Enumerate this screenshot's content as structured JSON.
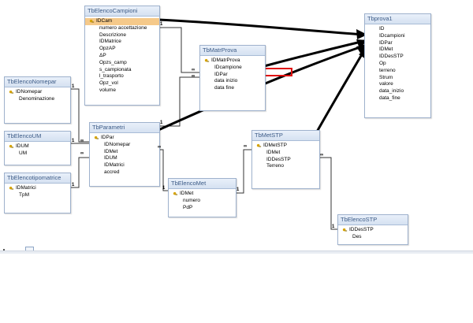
{
  "tables": {
    "elenco_campioni": {
      "title": "TbElencoCampioni",
      "fields": [
        "IDCam",
        "numero accettazione",
        "Descrizione",
        "IDMatrice",
        "OpzAP",
        "ΔP",
        "Opzs_camp",
        "s_campionata",
        "l_trasporto",
        "Opz_vol",
        "volume"
      ]
    },
    "matr_prova": {
      "title": "TbMatrProva",
      "fields": [
        "IDMatrProva",
        "IDcampione",
        "IDPar",
        "data inizio",
        "data fine"
      ]
    },
    "prova1": {
      "title": "Tbprova1",
      "fields": [
        "ID",
        "IDcampioni",
        "IDPar",
        "IDMet",
        "IDDesSTP",
        "Op",
        "terreno",
        "Strum",
        "valore",
        "data_inizio",
        "data_fine"
      ]
    },
    "elenco_nomepar": {
      "title": "TbElencoNomepar",
      "fields": [
        "IDNomepar",
        "Denominazione"
      ]
    },
    "elenco_um": {
      "title": "TbElencoUM",
      "fields": [
        "IDUM",
        "UM"
      ]
    },
    "elenco_tipomatrice": {
      "title": "TbElencotipomatrice",
      "fields": [
        "IDMatrici",
        "TpM"
      ]
    },
    "parametri": {
      "title": "TbParametri",
      "fields": [
        "IDPar",
        "IDNomepar",
        "IDMet",
        "IDUM",
        "IDMatrici",
        "accred"
      ]
    },
    "elenco_met": {
      "title": "TbElencoMet",
      "fields": [
        "IDMet",
        "numero",
        "PdP"
      ]
    },
    "met_stp": {
      "title": "TbMetSTP",
      "fields": [
        "IDMetSTP",
        "IDMet",
        "IDDesSTP",
        "Terreno"
      ]
    },
    "elenco_stp": {
      "title": "TbElencoSTP",
      "fields": [
        "IDDesSTP",
        "Des"
      ]
    }
  },
  "relationship_markers": {
    "one": "1",
    "many": "∞"
  },
  "colors": {
    "arrow": "#000000",
    "highlight_arrow": "#e01010",
    "selected_field": "#f5c98a",
    "table_header": "#d5e1f1",
    "table_border": "#9eb1cc"
  }
}
